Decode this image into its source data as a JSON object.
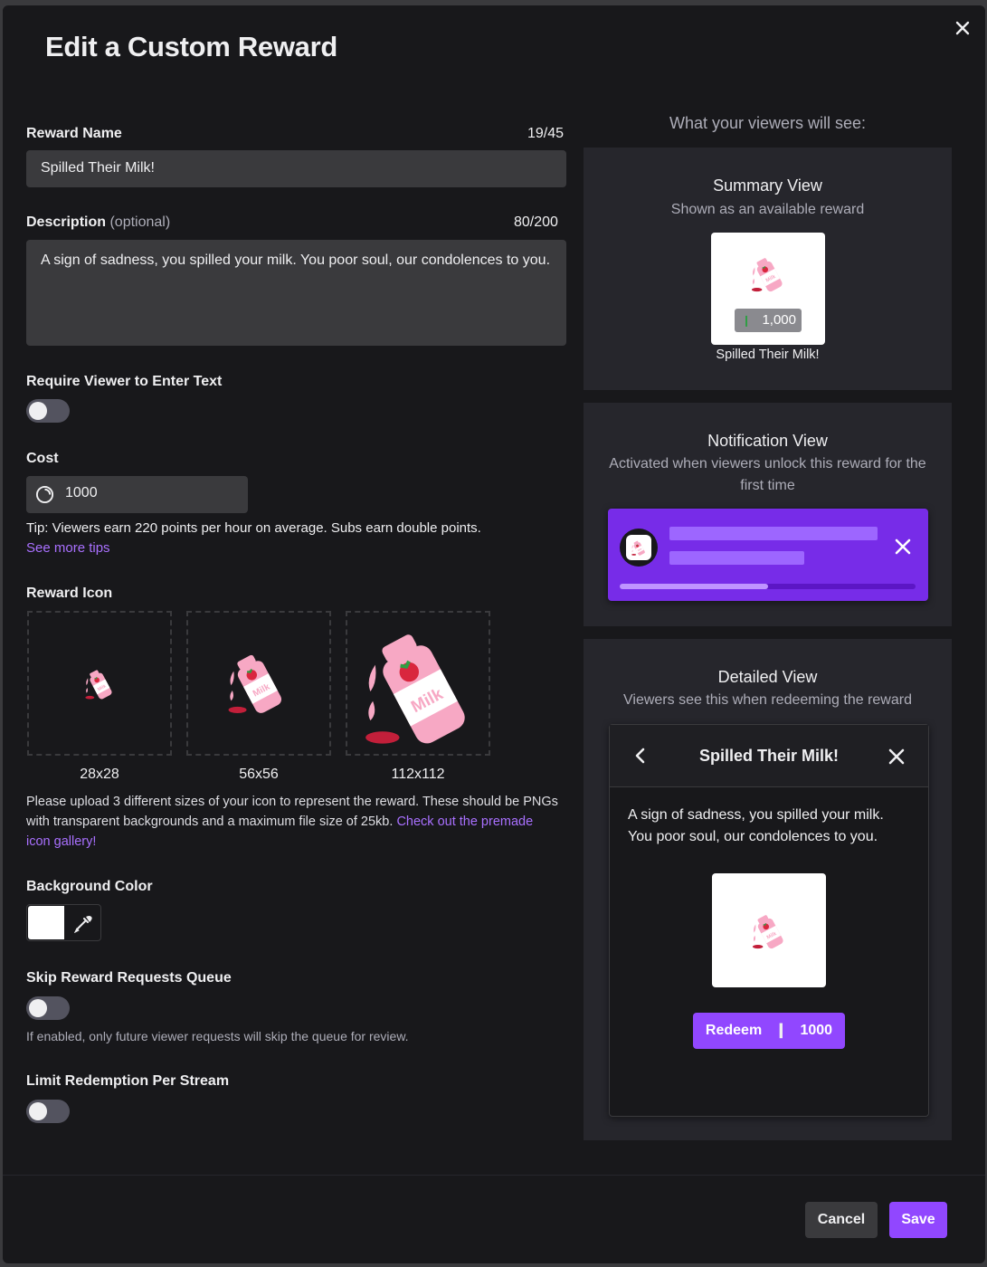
{
  "modal": {
    "title": "Edit a Custom Reward"
  },
  "reward_name": {
    "label": "Reward Name",
    "counter": "19/45",
    "value": "Spilled Their Milk!"
  },
  "description": {
    "label": "Description",
    "optional": "(optional)",
    "counter": "80/200",
    "value": "A sign of sadness, you spilled your milk. You poor soul, our condolences to you."
  },
  "require_text": {
    "label": "Require Viewer to Enter Text",
    "enabled": false
  },
  "cost": {
    "label": "Cost",
    "value": "1000",
    "tip": "Tip: Viewers earn 220 points per hour on average. Subs earn double points.",
    "tips_link": "See more tips"
  },
  "reward_icon": {
    "label": "Reward Icon",
    "sizes": [
      "28x28",
      "56x56",
      "112x112"
    ],
    "help": "Please upload 3 different sizes of your icon to represent the reward. These should be PNGs with transparent backgrounds and a maximum file size of 25kb.",
    "gallery_link": "Check out the premade icon gallery!"
  },
  "background_color": {
    "label": "Background Color",
    "value": "#ffffff"
  },
  "skip_queue": {
    "label": "Skip Reward Requests Queue",
    "enabled": false,
    "help": "If enabled, only future viewer requests will skip the queue for review."
  },
  "limit_redemption": {
    "label": "Limit Redemption Per Stream",
    "enabled": false
  },
  "preview": {
    "heading": "What your viewers will see:",
    "summary": {
      "title": "Summary View",
      "subtitle": "Shown as an available reward",
      "cost": "1,000",
      "name": "Spilled Their Milk!"
    },
    "notification": {
      "title": "Notification View",
      "subtitle": "Activated when viewers unlock this reward for the first time",
      "progress": 0.5
    },
    "detailed": {
      "title": "Detailed View",
      "subtitle": "Viewers see this when redeeming the reward",
      "name": "Spilled Their Milk!",
      "description": "A sign of sadness, you spilled your milk. You poor soul, our condolences to you.",
      "redeem_label": "Redeem",
      "cost": "1000"
    }
  },
  "footer": {
    "cancel": "Cancel",
    "save": "Save"
  },
  "colors": {
    "accent": "#9147ff",
    "link": "#a970ff",
    "background": "#18181b"
  }
}
